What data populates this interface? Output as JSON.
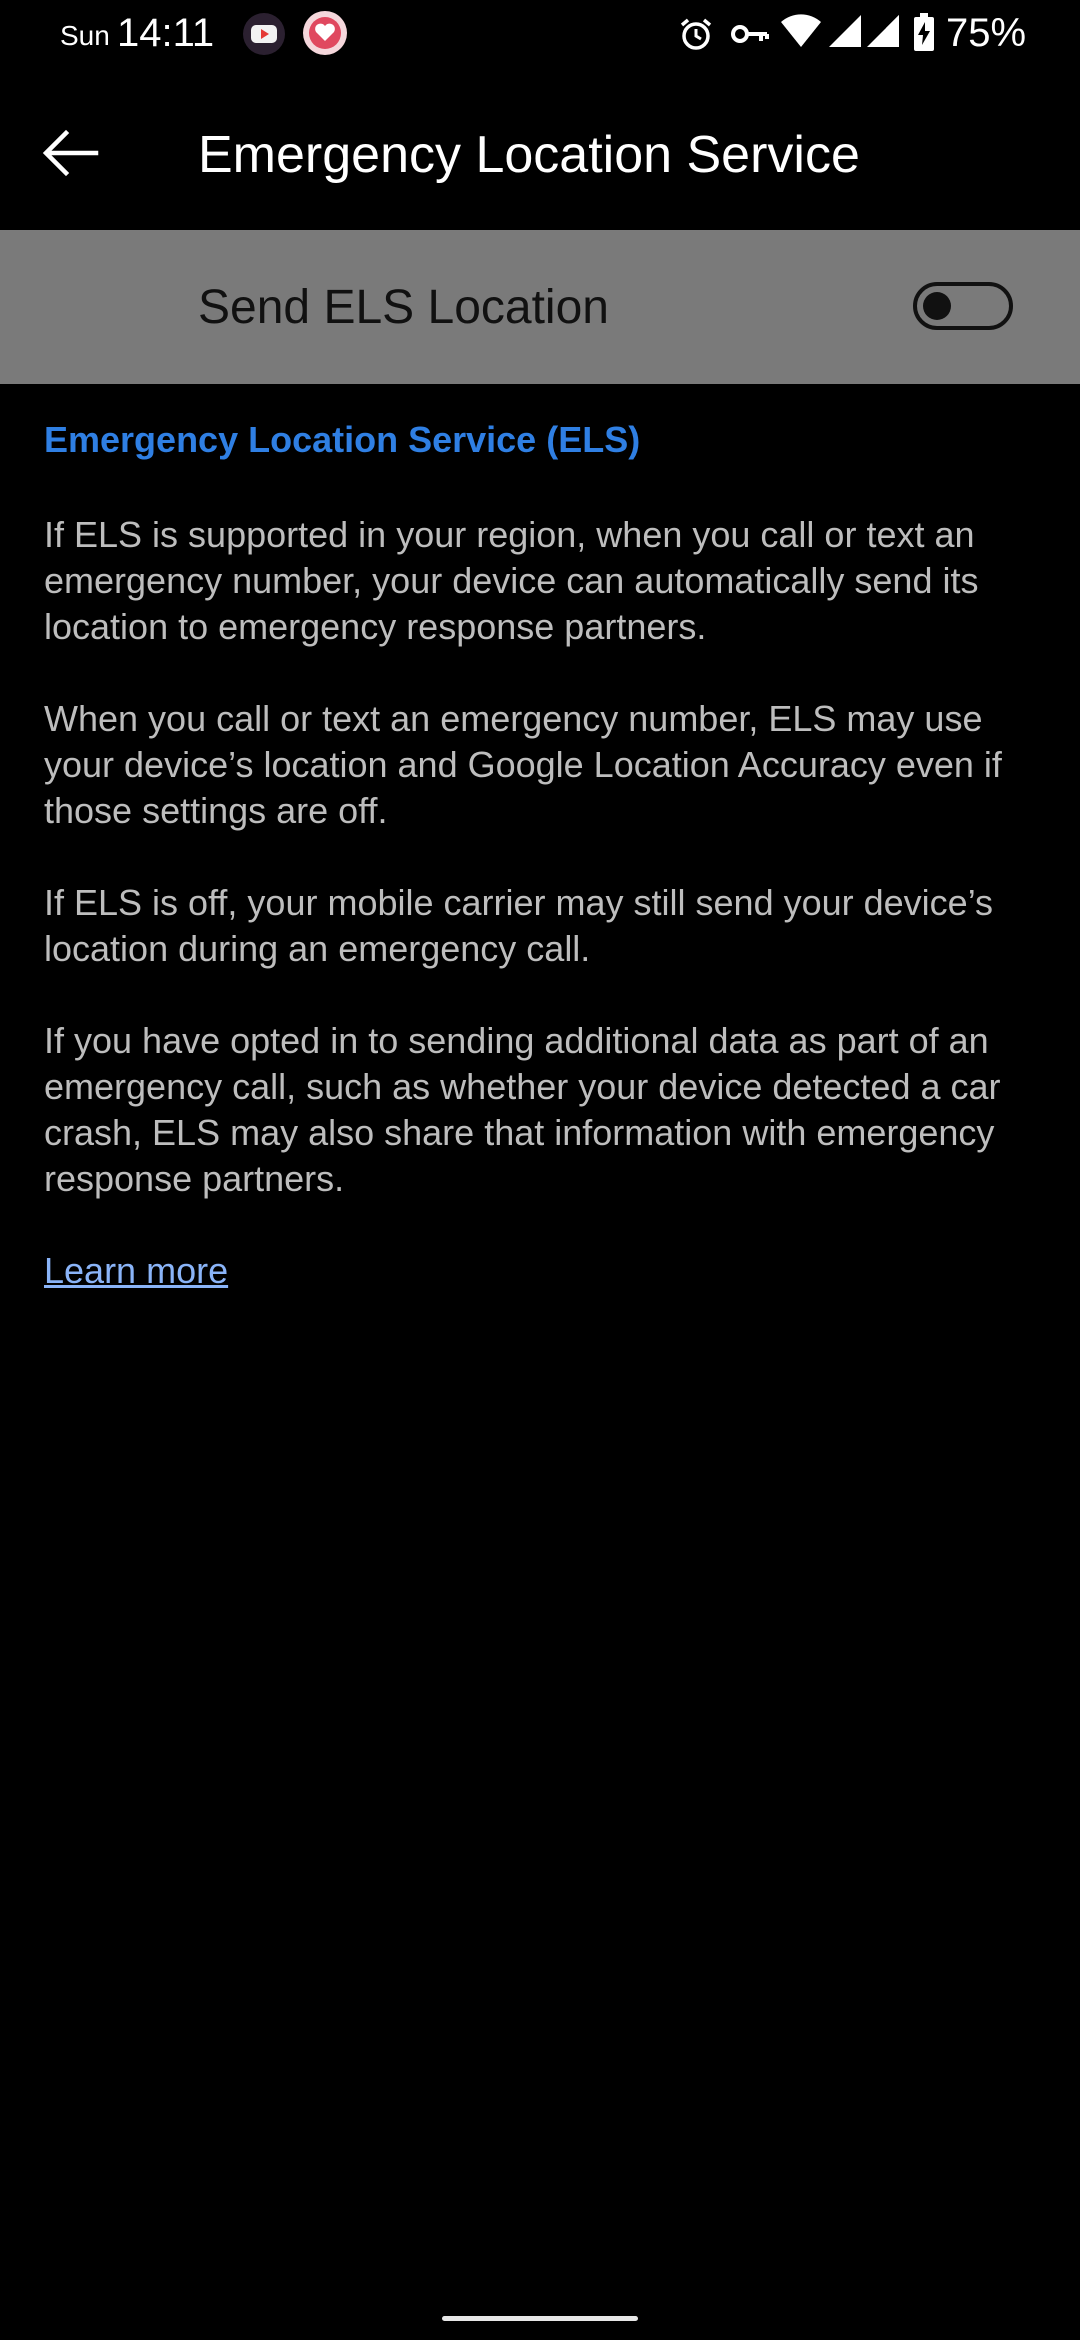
{
  "status_bar": {
    "day": "Sun",
    "time": "14:11",
    "battery_percent": "75%",
    "icons": [
      "youtube-app-icon",
      "heart-app-icon",
      "alarm-icon",
      "vpn-key-icon",
      "wifi-icon",
      "cell-signal-icon",
      "cell-signal-icon",
      "battery-charging-icon"
    ]
  },
  "app_bar": {
    "title": "Emergency Location Service"
  },
  "toggle": {
    "label": "Send ELS Location",
    "checked": false
  },
  "content": {
    "heading": "Emergency Location Service (ELS)",
    "paragraphs": [
      "If ELS is supported in your region, when you call or text an emergency number, your device can automatically send its location to emergency response partners.",
      "When you call or text an emergency number, ELS may use your device’s location and Google Location Accuracy even if those settings are off.",
      "If ELS is off, your mobile carrier may still send your device’s location during an emergency call.",
      "If you have opted in to sending additional data as part of an emergency call, such as whether your device detected a car crash, ELS may also share that information with emergency response partners."
    ],
    "learn_more": "Learn more"
  },
  "colors": {
    "background": "#000000",
    "toggle_row_bg": "#7a7a7a",
    "heading": "#2f7fe3",
    "body_text": "#bdbdbd",
    "link": "#8ab4f8"
  }
}
